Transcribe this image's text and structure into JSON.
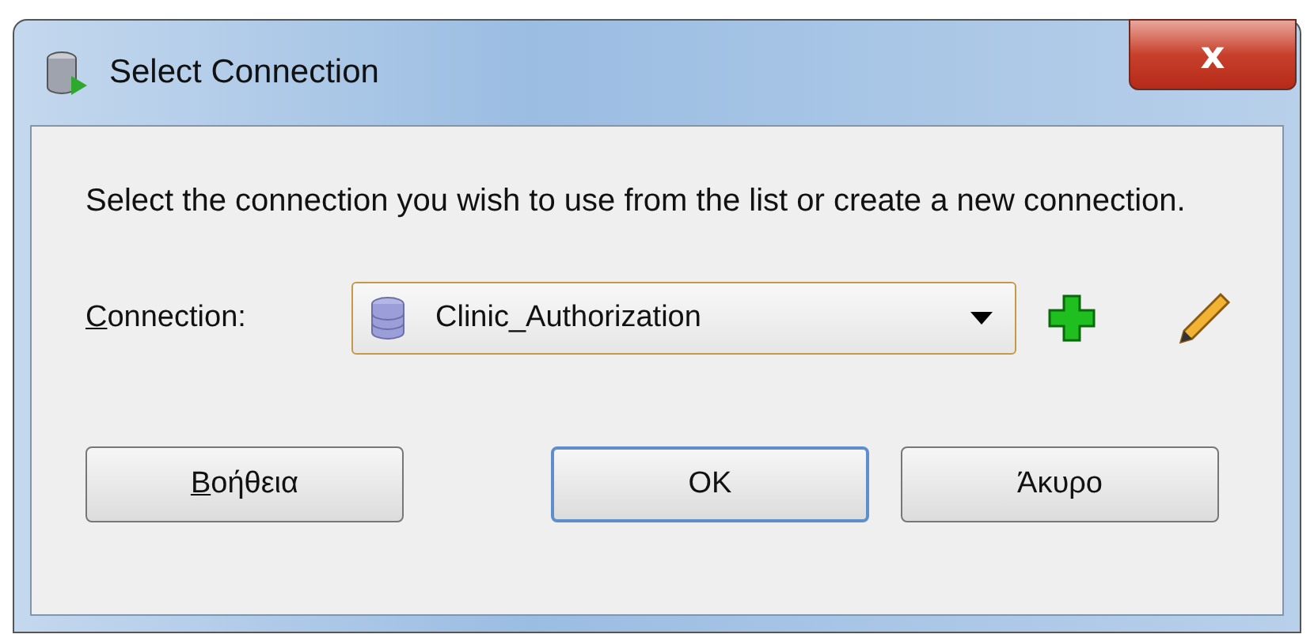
{
  "window": {
    "title": "Select Connection",
    "close_label": "x"
  },
  "message": "Select the connection you wish to use from the list or create a new connection.",
  "connection": {
    "label": "Connection:",
    "label_underline_first": true,
    "value": "Clinic_Authorization"
  },
  "buttons": [
    {
      "label": "Βοήθεια",
      "underline_first": true,
      "default": false
    },
    {
      "label": "OK",
      "underline_first": false,
      "default": true
    },
    {
      "label": "Άκυρο",
      "underline_first": false,
      "default": false
    }
  ]
}
